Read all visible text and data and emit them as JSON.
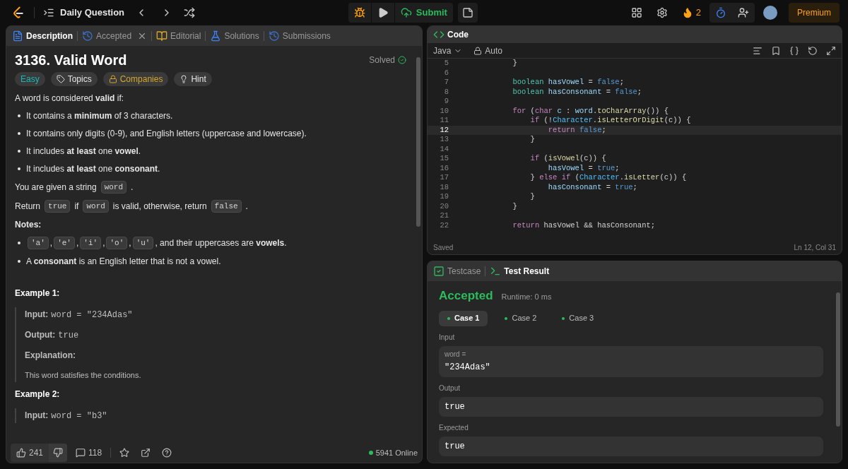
{
  "topbar": {
    "title": "Daily Question",
    "submit": "Submit",
    "streak": "2",
    "premium": "Premium"
  },
  "left_tabs": [
    {
      "label": "Description",
      "selected": true,
      "closable": false
    },
    {
      "label": "Accepted",
      "selected": false,
      "closable": true
    },
    {
      "label": "Editorial",
      "selected": false,
      "closable": false
    },
    {
      "label": "Solutions",
      "selected": false,
      "closable": false
    },
    {
      "label": "Submissions",
      "selected": false,
      "closable": false
    }
  ],
  "problem": {
    "title": "3136. Valid Word",
    "status": "Solved",
    "tags": [
      {
        "label": "Easy",
        "kind": "difficulty"
      },
      {
        "label": "Topics",
        "kind": "topics"
      },
      {
        "label": "Companies",
        "kind": "companies"
      },
      {
        "label": "Hint",
        "kind": "hint"
      }
    ],
    "content": [
      {
        "kind": "p",
        "parts": [
          {
            "kind": "text",
            "text": "A word is considered **valid** if:"
          }
        ]
      },
      {
        "kind": "li",
        "parts": [
          {
            "kind": "text",
            "text": "It contains a **minimum** of 3 characters."
          }
        ]
      },
      {
        "kind": "li",
        "parts": [
          {
            "kind": "text",
            "text": "It contains only digits (0-9), and English letters (uppercase and lowercase)."
          }
        ]
      },
      {
        "kind": "li",
        "parts": [
          {
            "kind": "text",
            "text": "It includes **at least** one **vowel**."
          }
        ]
      },
      {
        "kind": "li",
        "parts": [
          {
            "kind": "text",
            "text": "It includes **at least** one **consonant**."
          }
        ]
      },
      {
        "kind": "p",
        "parts": [
          {
            "kind": "text",
            "text": "You are given a string"
          },
          {
            "kind": "code",
            "text": "word"
          },
          {
            "kind": "text",
            "text": "."
          }
        ]
      },
      {
        "kind": "p",
        "parts": [
          {
            "kind": "text",
            "text": "Return"
          },
          {
            "kind": "code",
            "text": "true"
          },
          {
            "kind": "text",
            "text": "if"
          },
          {
            "kind": "code",
            "text": "word"
          },
          {
            "kind": "text",
            "text": "is valid, otherwise, return"
          },
          {
            "kind": "code",
            "text": "false"
          },
          {
            "kind": "text",
            "text": "."
          }
        ]
      },
      {
        "kind": "p",
        "parts": [
          {
            "kind": "text",
            "text": "**Notes:**"
          }
        ]
      },
      {
        "kind": "li",
        "parts": [
          {
            "kind": "code",
            "text": "'a'"
          },
          {
            "kind": "text",
            "text": ","
          },
          {
            "kind": "code",
            "text": "'e'"
          },
          {
            "kind": "text",
            "text": ","
          },
          {
            "kind": "code",
            "text": "'i'"
          },
          {
            "kind": "text",
            "text": ","
          },
          {
            "kind": "code",
            "text": "'o'"
          },
          {
            "kind": "text",
            "text": ","
          },
          {
            "kind": "code",
            "text": "'u'"
          },
          {
            "kind": "text",
            "text": ", and their uppercases are **vowels**."
          }
        ]
      },
      {
        "kind": "li",
        "parts": [
          {
            "kind": "text",
            "text": "A **consonant** is an English letter that is not a vowel."
          }
        ]
      }
    ],
    "examples": [
      {
        "title": "Example 1:",
        "lines": [
          {
            "kind": "field",
            "label": "Input:",
            "value": "word = \"234Adas\""
          },
          {
            "kind": "field",
            "label": "Output:",
            "value": "true"
          },
          {
            "kind": "field",
            "label": "Explanation:"
          },
          {
            "kind": "text",
            "value": "This word satisfies the conditions."
          }
        ]
      },
      {
        "title": "Example 2:",
        "lines": [
          {
            "kind": "field",
            "label": "Input:",
            "value": "word = \"b3\""
          }
        ]
      }
    ]
  },
  "footer": {
    "likes": "241",
    "comments": "118",
    "online": "5941 Online"
  },
  "code_panel": {
    "title": "Code",
    "language": "Java",
    "mode": "Auto",
    "status": "Saved",
    "cursor": "Ln 12, Col 31",
    "lines": [
      {
        "n": "5",
        "current": false,
        "tokens": [
          {
            "kind": "plain",
            "text": "        }"
          }
        ]
      },
      {
        "n": "6",
        "current": false
      },
      {
        "n": "7",
        "current": false,
        "tokens": [
          {
            "kind": "type",
            "text": "        boolean"
          },
          {
            "kind": "var",
            "text": " hasVowel"
          },
          {
            "kind": "plain",
            "text": " = "
          },
          {
            "kind": "lit",
            "text": "false"
          },
          {
            "kind": "plain",
            "text": ";"
          }
        ]
      },
      {
        "n": "8",
        "current": false,
        "tokens": [
          {
            "kind": "type",
            "text": "        boolean"
          },
          {
            "kind": "var",
            "text": " hasConsonant"
          },
          {
            "kind": "plain",
            "text": " = "
          },
          {
            "kind": "lit",
            "text": "false"
          },
          {
            "kind": "plain",
            "text": ";"
          }
        ]
      },
      {
        "n": "9",
        "current": false
      },
      {
        "n": "10",
        "current": false,
        "tokens": [
          {
            "kind": "kw",
            "text": "        for"
          },
          {
            "kind": "plain",
            "text": " ("
          },
          {
            "kind": "kw",
            "text": "char"
          },
          {
            "kind": "var",
            "text": " c"
          },
          {
            "kind": "plain",
            "text": " : "
          },
          {
            "kind": "var",
            "text": "word"
          },
          {
            "kind": "plain",
            "text": "."
          },
          {
            "kind": "fn",
            "text": "toCharArray"
          },
          {
            "kind": "plain",
            "text": "()) {"
          }
        ]
      },
      {
        "n": "11",
        "current": false,
        "tokens": [
          {
            "kind": "kw",
            "text": "            if"
          },
          {
            "kind": "plain",
            "text": " (!"
          },
          {
            "kind": "cls",
            "text": "Character"
          },
          {
            "kind": "plain",
            "text": "."
          },
          {
            "kind": "fn",
            "text": "isLetterOrDigit"
          },
          {
            "kind": "plain",
            "text": "(c)) {"
          }
        ]
      },
      {
        "n": "12",
        "current": true,
        "tokens": [
          {
            "kind": "kw",
            "text": "                return"
          },
          {
            "kind": "lit",
            "text": " false"
          },
          {
            "kind": "plain",
            "text": ";"
          }
        ]
      },
      {
        "n": "13",
        "current": false,
        "tokens": [
          {
            "kind": "plain",
            "text": "            }"
          }
        ]
      },
      {
        "n": "14",
        "current": false
      },
      {
        "n": "15",
        "current": false,
        "tokens": [
          {
            "kind": "kw",
            "text": "            if"
          },
          {
            "kind": "plain",
            "text": " ("
          },
          {
            "kind": "fn",
            "text": "isVowel"
          },
          {
            "kind": "plain",
            "text": "(c)) {"
          }
        ]
      },
      {
        "n": "16",
        "current": false,
        "tokens": [
          {
            "kind": "var",
            "text": "                hasVowel"
          },
          {
            "kind": "plain",
            "text": " = "
          },
          {
            "kind": "lit",
            "text": "true"
          },
          {
            "kind": "plain",
            "text": ";"
          }
        ]
      },
      {
        "n": "17",
        "current": false,
        "tokens": [
          {
            "kind": "plain",
            "text": "            } "
          },
          {
            "kind": "kw",
            "text": "else if"
          },
          {
            "kind": "plain",
            "text": " ("
          },
          {
            "kind": "cls",
            "text": "Character"
          },
          {
            "kind": "plain",
            "text": "."
          },
          {
            "kind": "fn",
            "text": "isLetter"
          },
          {
            "kind": "plain",
            "text": "(c)) {"
          }
        ]
      },
      {
        "n": "18",
        "current": false,
        "tokens": [
          {
            "kind": "var",
            "text": "                hasConsonant"
          },
          {
            "kind": "plain",
            "text": " = "
          },
          {
            "kind": "lit",
            "text": "true"
          },
          {
            "kind": "plain",
            "text": ";"
          }
        ]
      },
      {
        "n": "19",
        "current": false,
        "tokens": [
          {
            "kind": "plain",
            "text": "            }"
          }
        ]
      },
      {
        "n": "20",
        "current": false,
        "tokens": [
          {
            "kind": "plain",
            "text": "        }"
          }
        ]
      },
      {
        "n": "21",
        "current": false
      },
      {
        "n": "22",
        "current": false,
        "tokens": [
          {
            "kind": "kw",
            "text": "        return"
          },
          {
            "kind": "plain",
            "text": " hasVowel && hasConsonant;"
          }
        ]
      }
    ]
  },
  "result_tabs": [
    {
      "label": "Testcase",
      "selected": false
    },
    {
      "label": "Test Result",
      "selected": true
    }
  ],
  "result": {
    "verdict": "Accepted",
    "runtime": "Runtime: 0 ms",
    "cases": [
      {
        "label": "Case 1",
        "selected": true
      },
      {
        "label": "Case 2",
        "selected": false
      },
      {
        "label": "Case 3",
        "selected": false
      }
    ],
    "sections": [
      {
        "label": "Input",
        "var": "word =",
        "value": "\"234Adas\""
      },
      {
        "label": "Output",
        "value": "true"
      },
      {
        "label": "Expected",
        "value": "true"
      }
    ]
  }
}
